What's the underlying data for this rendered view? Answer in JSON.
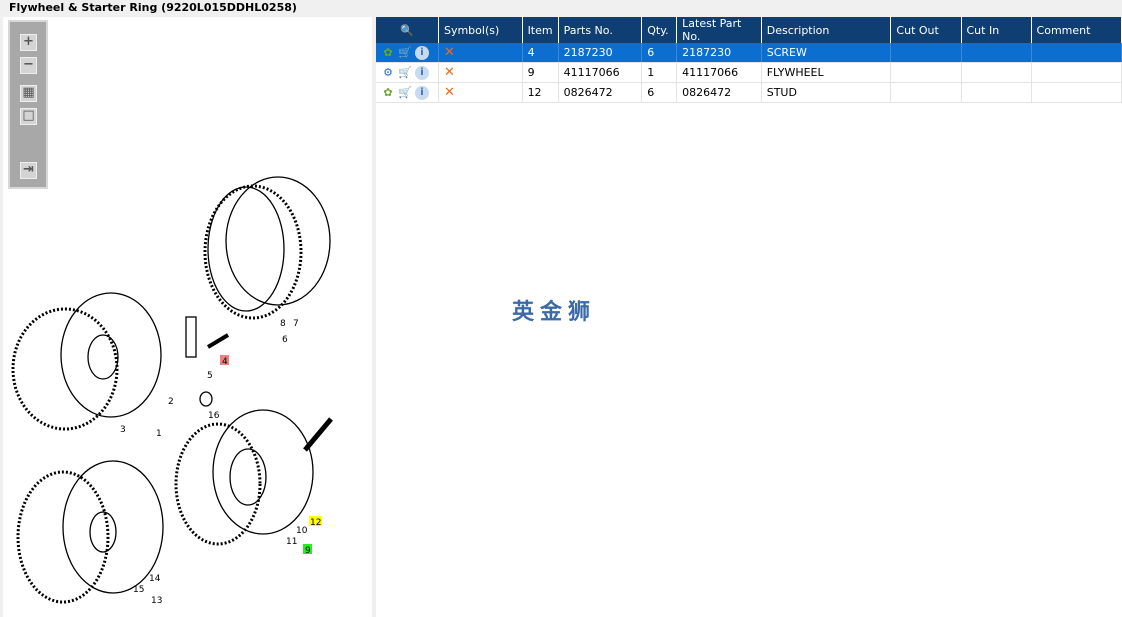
{
  "title": "Flywheel & Starter Ring (9220L015DDHL0258)",
  "toolbar": {
    "zoom_in": "+",
    "zoom_out": "−",
    "fit": "▦",
    "actual": "□",
    "export": "⇥"
  },
  "table": {
    "headers": [
      "Symbol(s)",
      "Item",
      "Parts No.",
      "Qty.",
      "Latest Part No.",
      "Description",
      "Cut Out",
      "Cut In",
      "Comment"
    ],
    "rows": [
      {
        "item": "4",
        "part": "2187230",
        "qty": "6",
        "latest": "2187230",
        "desc": "SCREW",
        "cut_out": "",
        "cut_in": "",
        "comment": "",
        "selected": true
      },
      {
        "item": "9",
        "part": "41117066",
        "qty": "1",
        "latest": "41117066",
        "desc": "FLYWHEEL",
        "cut_out": "",
        "cut_in": "",
        "comment": ""
      },
      {
        "item": "12",
        "part": "0826472",
        "qty": "6",
        "latest": "0826472",
        "desc": "STUD",
        "cut_out": "",
        "cut_in": "",
        "comment": ""
      }
    ]
  },
  "watermark": "英金狮",
  "diagram": {
    "labels": [
      "1",
      "2",
      "3",
      "4",
      "5",
      "6",
      "7",
      "8",
      "9",
      "10",
      "11",
      "12",
      "13",
      "14",
      "15",
      "16"
    ]
  }
}
